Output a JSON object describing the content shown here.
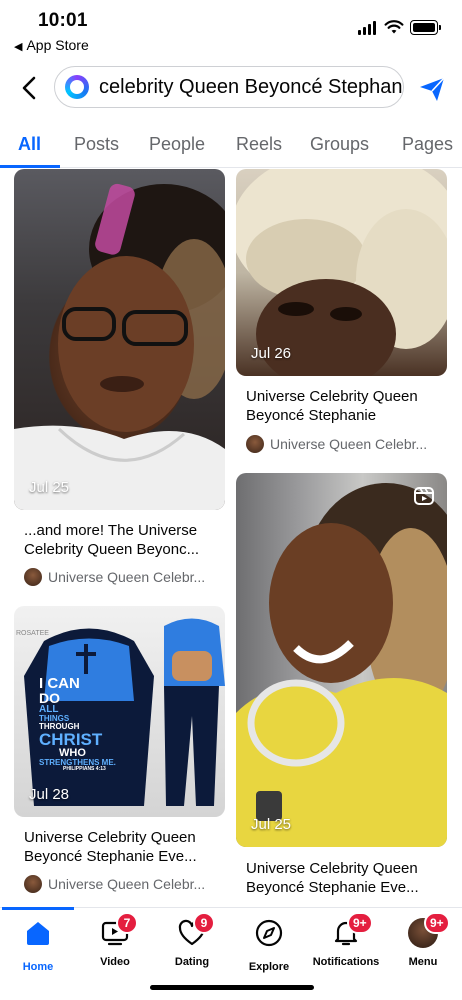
{
  "status": {
    "time": "10:01",
    "back_app": "App Store"
  },
  "search": {
    "query": "celebrity Queen Beyoncé Stephanie"
  },
  "tabs": [
    "All",
    "Posts",
    "People",
    "Reels",
    "Groups",
    "Pages"
  ],
  "active_tab": "All",
  "results": [
    {
      "date": "Jul 25",
      "title": "...and more! The Universe Celebrity Queen Beyonc...",
      "author": "Universe Queen Celebr..."
    },
    {
      "date": "Jul 26",
      "title": "Universe Celebrity Queen Beyoncé Stephanie",
      "author": "Universe Queen Celebr..."
    },
    {
      "date": "Jul 25",
      "title": "Universe Celebrity Queen Beyoncé Stephanie Eve...",
      "author": "",
      "is_reel": true
    },
    {
      "date": "Jul 28",
      "title": "Universe Celebrity Queen Beyoncé Stephanie Eve...",
      "author": "Universe Queen Celebr...",
      "graphic": {
        "brand": "ROSATEE",
        "lines": [
          "I CAN",
          "DO",
          "ALL",
          "THINGS",
          "THROUGH",
          "CHRIST",
          "WHO",
          "STRENGTHENS ME.",
          "PHILIPPIANS 4:13"
        ]
      }
    }
  ],
  "bottom_nav": [
    {
      "label": "Home",
      "badge": ""
    },
    {
      "label": "Video",
      "badge": "7"
    },
    {
      "label": "Dating",
      "badge": "9"
    },
    {
      "label": "Explore",
      "badge": ""
    },
    {
      "label": "Notifications",
      "badge": "9+"
    },
    {
      "label": "Menu",
      "badge": "9+"
    }
  ],
  "colors": {
    "accent": "#0866ff",
    "badge": "#e41e3f",
    "muted": "#65676b"
  }
}
